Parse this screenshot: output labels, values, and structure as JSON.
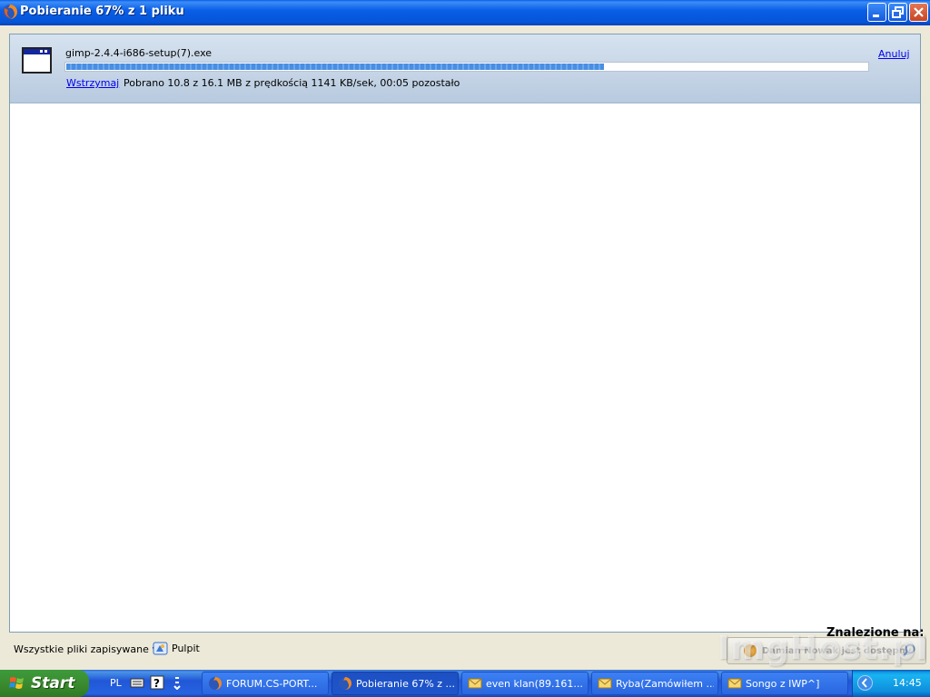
{
  "window": {
    "title": "Pobieranie 67% z 1 pliku"
  },
  "download": {
    "filename": "gimp-2.4.4-i686-setup(7).exe",
    "progress_percent": 67,
    "pause_label": "Wstrzymaj",
    "status_text": "Pobrano 10.8 z 16.1 MB z prędkością 1141 KB/sek, 00:05 pozostało",
    "cancel_label": "Anuluj",
    "icon": "application-window-icon"
  },
  "footer": {
    "label": "Wszystkie pliki zapisywane w:",
    "folder": "Pulpit",
    "folder_icon": "desktop-folder-icon"
  },
  "overlay": {
    "found_label": "Znalezione na:",
    "notification_text": "Damian Nowak jest dostępny",
    "watermark": "ImgHost.pl"
  },
  "taskbar": {
    "start_label": "Start",
    "language": "PL",
    "tasks": [
      {
        "label": "FORUM.CS-PORT...",
        "icon": "firefox-icon",
        "active": false
      },
      {
        "label": "Pobieranie 67% z ...",
        "icon": "firefox-icon",
        "active": true
      },
      {
        "label": "even klan(89.161...",
        "icon": "mail-icon",
        "active": false
      },
      {
        "label": "Ryba(Zamówiłem ...",
        "icon": "mail-icon",
        "active": false
      },
      {
        "label": "Songo z IWP^]",
        "icon": "mail-icon",
        "active": false
      }
    ],
    "clock": "14:45"
  },
  "colors": {
    "titlebar": "#0a5ee6",
    "taskbar": "#2157d7",
    "start_green": "#3b8b2f",
    "progress_fill": "#4a8ee2",
    "link": "#0000ee"
  }
}
